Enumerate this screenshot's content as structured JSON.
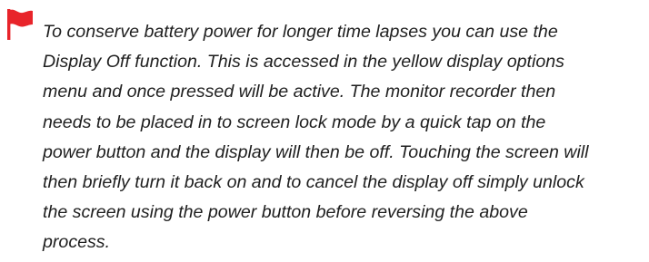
{
  "note": {
    "icon": "red-flag-icon",
    "flag_color": "#e8242a",
    "text_lines": [
      "To conserve battery power for longer time lapses you can use the",
      "Display Off function. This is accessed in the yellow display options",
      "menu and once pressed will be active. The monitor recorder then",
      "needs to be placed in to screen lock mode by a quick tap on the",
      "power button and the display will then be off. Touching the screen will",
      "then briefly turn it back on and to cancel the display off simply unlock",
      "the screen using the power button before reversing the above",
      "process."
    ]
  }
}
